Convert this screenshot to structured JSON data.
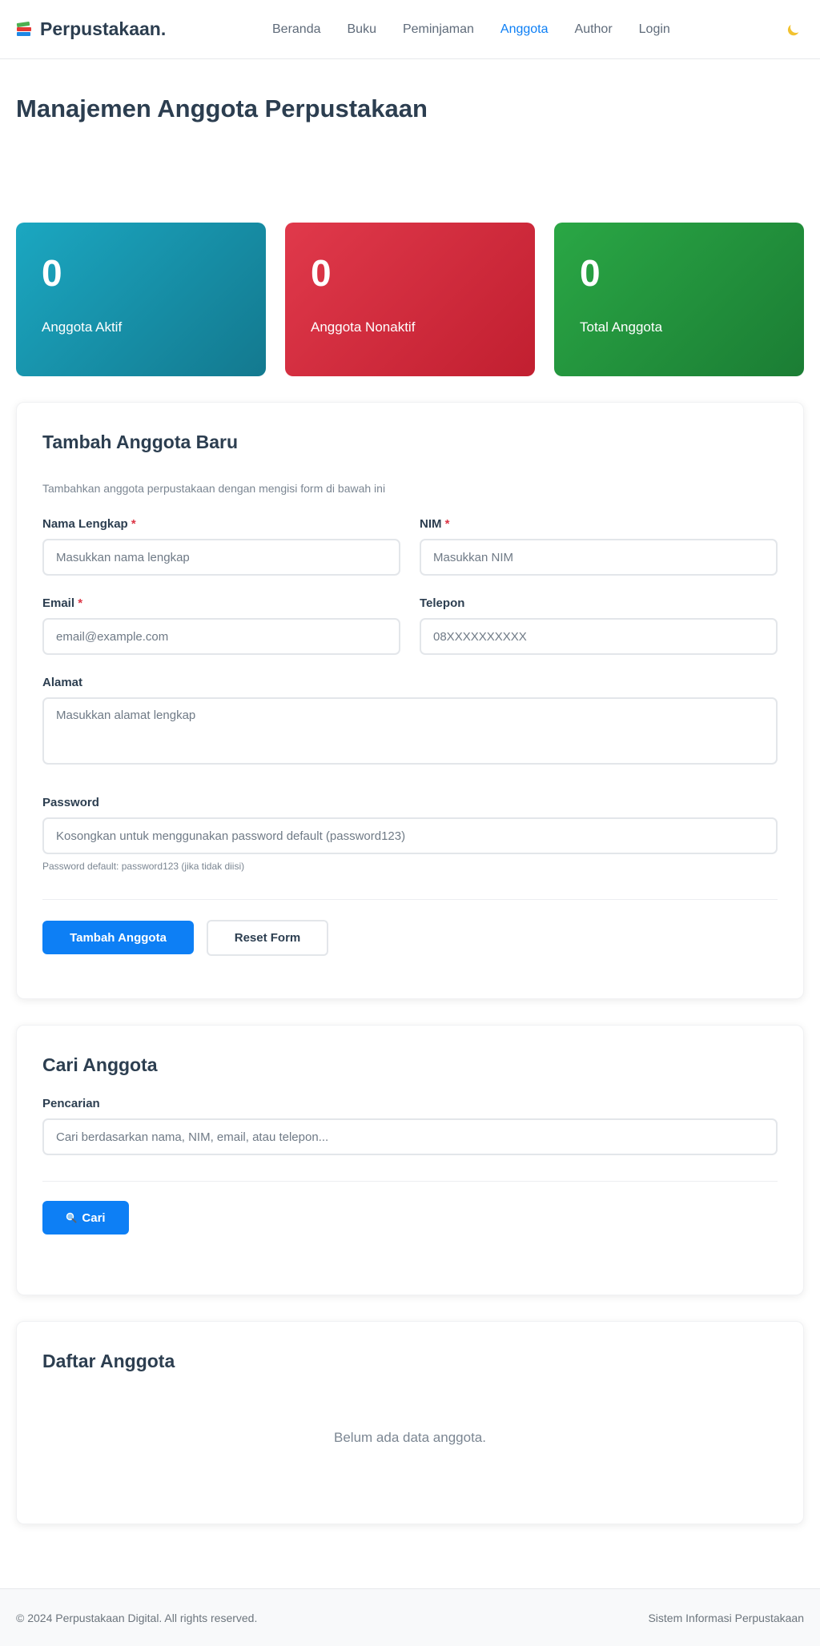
{
  "navbar": {
    "brand_icon": "books-icon",
    "brand_title": "Perpustakaan.",
    "links": [
      {
        "label": "Beranda",
        "active": false
      },
      {
        "label": "Buku",
        "active": false
      },
      {
        "label": "Peminjaman",
        "active": false
      },
      {
        "label": "Anggota",
        "active": true
      },
      {
        "label": "Author",
        "active": false
      },
      {
        "label": "Login",
        "active": false
      }
    ],
    "theme_toggle_icon": "moon-icon"
  },
  "page": {
    "title": "Manajemen Anggota Perpustakaan"
  },
  "stats": [
    {
      "value": "0",
      "label": "Anggota Aktif",
      "color": "#17a2b8"
    },
    {
      "value": "0",
      "label": "Anggota Nonaktif",
      "color": "#dc3545"
    },
    {
      "value": "0",
      "label": "Total Anggota",
      "color": "#28a745"
    }
  ],
  "add_form": {
    "title": "Tambah Anggota Baru",
    "subtitle": "Tambahkan anggota perpustakaan dengan mengisi form di bawah ini",
    "required_mark": "*",
    "nama": {
      "label": "Nama Lengkap",
      "placeholder": "Masukkan nama lengkap",
      "value": ""
    },
    "nim": {
      "label": "NIM",
      "placeholder": "Masukkan NIM",
      "value": ""
    },
    "email": {
      "label": "Email",
      "placeholder": "email@example.com",
      "value": ""
    },
    "telepon": {
      "label": "Telepon",
      "placeholder": "08XXXXXXXXXX",
      "value": ""
    },
    "alamat": {
      "label": "Alamat",
      "placeholder": "Masukkan alamat lengkap",
      "value": ""
    },
    "password": {
      "label": "Password",
      "placeholder": "Kosongkan untuk menggunakan password default (password123)",
      "value": "",
      "help": "Password default: password123 (jika tidak diisi)"
    },
    "submit_label": "Tambah Anggota",
    "reset_label": "Reset Form"
  },
  "search": {
    "title": "Cari Anggota",
    "label": "Pencarian",
    "placeholder": "Cari berdasarkan nama, NIM, email, atau telepon...",
    "value": "",
    "button_icon": "search-icon",
    "button_label": "Cari"
  },
  "members": {
    "title": "Daftar Anggota",
    "empty_text": "Belum ada data anggota."
  },
  "footer": {
    "copyright": "© 2024 Perpustakaan Digital. All rights reserved.",
    "tagline": "Sistem Informasi Perpustakaan"
  },
  "colors": {
    "primary": "#0d7ff5",
    "text_dark": "#2c3e50",
    "required": "#dc3545"
  }
}
